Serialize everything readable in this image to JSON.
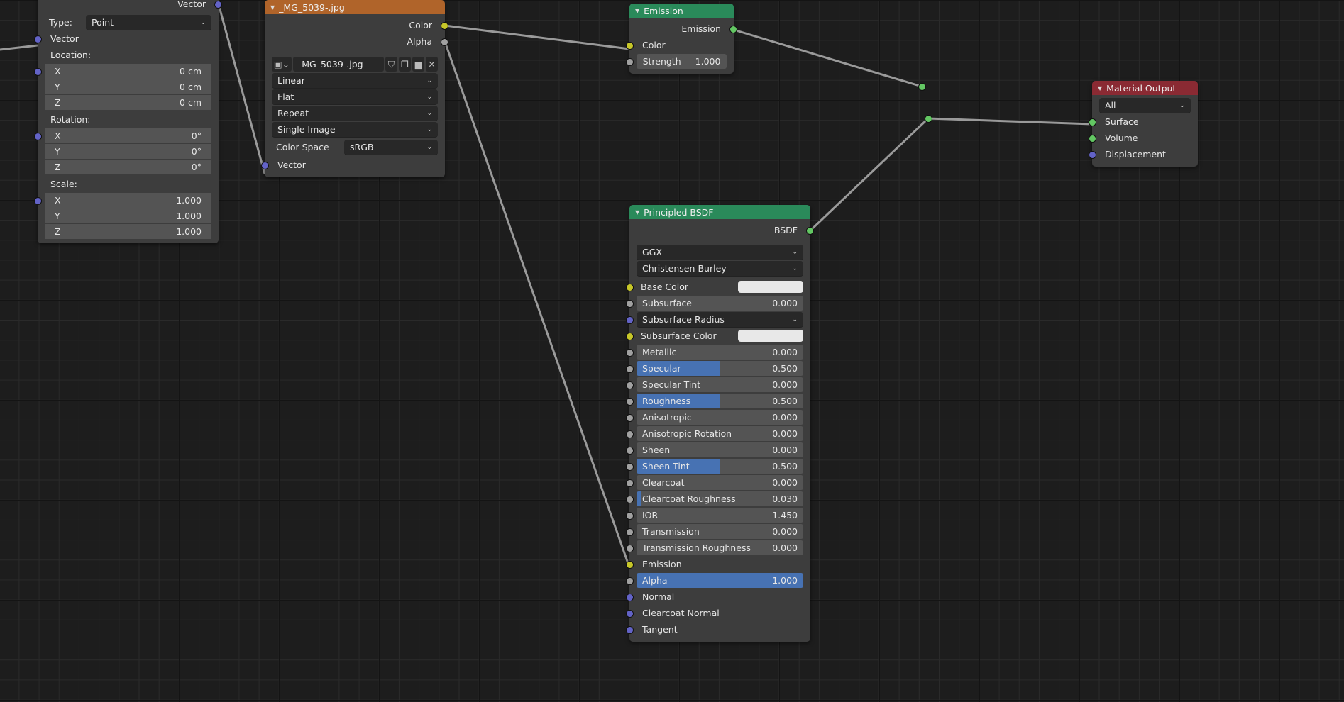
{
  "colors": {
    "socket_vector": "#6363c7",
    "socket_color": "#c7c729",
    "socket_float": "#a1a1a1",
    "socket_shader": "#63c763",
    "header_texture": "#b0642a",
    "header_shader": "#2a8a5a",
    "header_output": "#8a2a33",
    "fill": "#4772b3"
  },
  "nodes": [
    {
      "id": "mapping",
      "title": "",
      "rows": [
        {
          "t": "out",
          "label": "Vector",
          "sock": "vector"
        },
        {
          "t": "ddl",
          "label": "Type:",
          "value": "Point"
        },
        {
          "t": "in",
          "label": "Vector",
          "sock": "vector"
        },
        {
          "t": "lbl",
          "label": "Location:"
        },
        {
          "t": "fld",
          "label": "X",
          "value": "0 cm",
          "grp": 1,
          "sock": "vector"
        },
        {
          "t": "fld",
          "label": "Y",
          "value": "0 cm",
          "grp": 1
        },
        {
          "t": "fld",
          "label": "Z",
          "value": "0 cm",
          "grp": 1
        },
        {
          "t": "lbl",
          "label": "Rotation:"
        },
        {
          "t": "fld",
          "label": "X",
          "value": "0°",
          "grp": 1,
          "sock": "vector"
        },
        {
          "t": "fld",
          "label": "Y",
          "value": "0°",
          "grp": 1
        },
        {
          "t": "fld",
          "label": "Z",
          "value": "0°",
          "grp": 1
        },
        {
          "t": "lbl",
          "label": "Scale:"
        },
        {
          "t": "fld",
          "label": "X",
          "value": "1.000",
          "grp": 1,
          "sock": "vector"
        },
        {
          "t": "fld",
          "label": "Y",
          "value": "1.000",
          "grp": 1
        },
        {
          "t": "fld",
          "label": "Z",
          "value": "1.000",
          "grp": 1
        }
      ]
    },
    {
      "id": "image",
      "title": "_MG_5039-.jpg",
      "header": "header_texture",
      "rows": [
        {
          "t": "out",
          "label": "Color",
          "sock": "color"
        },
        {
          "t": "out",
          "label": "Alpha",
          "sock": "float"
        },
        {
          "t": "file",
          "value": "_MG_5039-.jpg",
          "icons": [
            "image-icon",
            "shield-icon",
            "duplicate-icon",
            "folder-icon",
            "close-icon"
          ]
        },
        {
          "t": "dd",
          "value": "Linear"
        },
        {
          "t": "dd",
          "value": "Flat"
        },
        {
          "t": "dd",
          "value": "Repeat"
        },
        {
          "t": "dd",
          "value": "Single Image"
        },
        {
          "t": "ddl",
          "label": "Color Space",
          "value": "sRGB"
        },
        {
          "t": "in",
          "label": "Vector",
          "sock": "vector"
        }
      ]
    },
    {
      "id": "emission",
      "title": "Emission",
      "header": "header_shader",
      "rows": [
        {
          "t": "out",
          "label": "Emission",
          "sock": "shader"
        },
        {
          "t": "in",
          "label": "Color",
          "sock": "color"
        },
        {
          "t": "fld",
          "label": "Strength",
          "value": "1.000",
          "sock": "float",
          "center": 1
        }
      ]
    },
    {
      "id": "bsdf",
      "title": "Principled BSDF",
      "header": "header_shader",
      "rows": [
        {
          "t": "out",
          "label": "BSDF",
          "sock": "shader"
        },
        {
          "t": "dd",
          "value": "GGX"
        },
        {
          "t": "dd",
          "value": "Christensen-Burley"
        },
        {
          "t": "color",
          "label": "Base Color",
          "sock": "color"
        },
        {
          "t": "fld",
          "label": "Subsurface",
          "value": "0.000",
          "sock": "float"
        },
        {
          "t": "dd",
          "value": "Subsurface Radius",
          "sock": "vector"
        },
        {
          "t": "color",
          "label": "Subsurface Color",
          "sock": "color"
        },
        {
          "t": "fld",
          "label": "Metallic",
          "value": "0.000",
          "sock": "float"
        },
        {
          "t": "fld",
          "label": "Specular",
          "value": "0.500",
          "fill": 0.5,
          "sock": "float"
        },
        {
          "t": "fld",
          "label": "Specular Tint",
          "value": "0.000",
          "sock": "float"
        },
        {
          "t": "fld",
          "label": "Roughness",
          "value": "0.500",
          "fill": 0.5,
          "sock": "float"
        },
        {
          "t": "fld",
          "label": "Anisotropic",
          "value": "0.000",
          "sock": "float"
        },
        {
          "t": "fld",
          "label": "Anisotropic Rotation",
          "value": "0.000",
          "sock": "float"
        },
        {
          "t": "fld",
          "label": "Sheen",
          "value": "0.000",
          "sock": "float"
        },
        {
          "t": "fld",
          "label": "Sheen Tint",
          "value": "0.500",
          "fill": 0.5,
          "sock": "float"
        },
        {
          "t": "fld",
          "label": "Clearcoat",
          "value": "0.000",
          "sock": "float"
        },
        {
          "t": "fld",
          "label": "Clearcoat Roughness",
          "value": "0.030",
          "fill": 0.03,
          "sock": "float"
        },
        {
          "t": "fld",
          "label": "IOR",
          "value": "1.450",
          "sock": "float"
        },
        {
          "t": "fld",
          "label": "Transmission",
          "value": "0.000",
          "sock": "float"
        },
        {
          "t": "fld",
          "label": "Transmission Roughness",
          "value": "0.000",
          "sock": "float"
        },
        {
          "t": "in",
          "label": "Emission",
          "sock": "color"
        },
        {
          "t": "fld",
          "label": "Alpha",
          "value": "1.000",
          "fill": 1,
          "sock": "float"
        },
        {
          "t": "in",
          "label": "Normal",
          "sock": "vector"
        },
        {
          "t": "in",
          "label": "Clearcoat Normal",
          "sock": "vector"
        },
        {
          "t": "in",
          "label": "Tangent",
          "sock": "vector"
        }
      ]
    },
    {
      "id": "output",
      "title": "Material Output",
      "header": "header_output",
      "rows": [
        {
          "t": "dd",
          "value": "All"
        },
        {
          "t": "in",
          "label": "Surface",
          "sock": "shader"
        },
        {
          "t": "in",
          "label": "Volume",
          "sock": "shader"
        },
        {
          "t": "in",
          "label": "Displacement",
          "sock": "vector"
        }
      ]
    }
  ]
}
